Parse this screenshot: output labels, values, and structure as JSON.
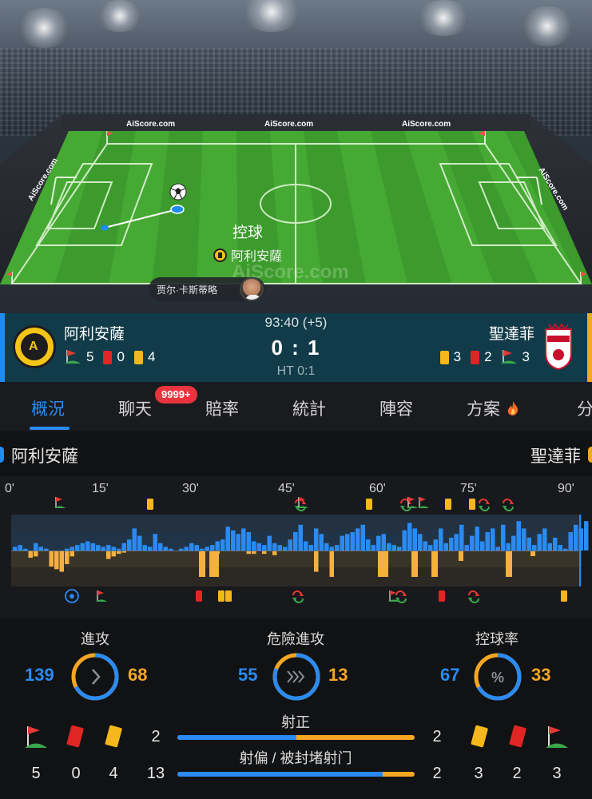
{
  "pitch": {
    "brand_top_left": "AiScore.com",
    "brand_top_center": "AiScore.com",
    "brand_top_right": "AiScore.com",
    "brand_side_left": "AiScore.com",
    "brand_side_right": "AiScore.com",
    "brand_pitch": "AiScore.com",
    "event_title": "控球",
    "event_team": "阿利安薩",
    "player_name": "贾尔·卡斯蒂略"
  },
  "match": {
    "home_name": "阿利安薩",
    "away_name": "聖達菲",
    "time": "93:40 (+5)",
    "score": "0 : 1",
    "halftime": "HT 0:1",
    "home_corners": "5",
    "home_red": "0",
    "home_yellow": "4",
    "away_yellow": "3",
    "away_red": "2",
    "away_corners": "3",
    "home_crest_text": "ALIANZA PETROLERA F.C.",
    "home_crest_year": "1990",
    "away_crest_text": "SANTA FE",
    "home_color": "#1e8cf0",
    "away_color": "#f5a623"
  },
  "tabs": {
    "items": [
      "概況",
      "聊天",
      "賠率",
      "統計",
      "陣容",
      "方案",
      "分"
    ],
    "active": "概況",
    "chat_badge": "9999+"
  },
  "momentum": {
    "home_label": "阿利安薩",
    "away_label": "聖達菲",
    "minutes": [
      "0'",
      "15'",
      "30'",
      "45'",
      "60'",
      "75'",
      "90'"
    ]
  },
  "stats": {
    "attacks": {
      "label": "進攻",
      "home": "139",
      "away": "68",
      "home_value": 139,
      "away_value": 68
    },
    "dangerous_attacks": {
      "label": "危險進攻",
      "home": "55",
      "away": "13",
      "home_value": 55,
      "away_value": 13
    },
    "possession": {
      "label": "控球率",
      "home": "67",
      "away": "33",
      "home_value": 67,
      "away_value": 33
    },
    "on_target": {
      "label": "射正",
      "home": "2",
      "away": "2",
      "home_value": 2,
      "away_value": 2
    },
    "off_target": {
      "label": "射偏 / 被封堵射门",
      "home": "13",
      "away": "2",
      "home_value": 13,
      "away_value": 2
    },
    "home_corners": "5",
    "home_red": "0",
    "home_yellow": "4",
    "away_yellow": "3",
    "away_red": "2",
    "away_corners": "3"
  }
}
